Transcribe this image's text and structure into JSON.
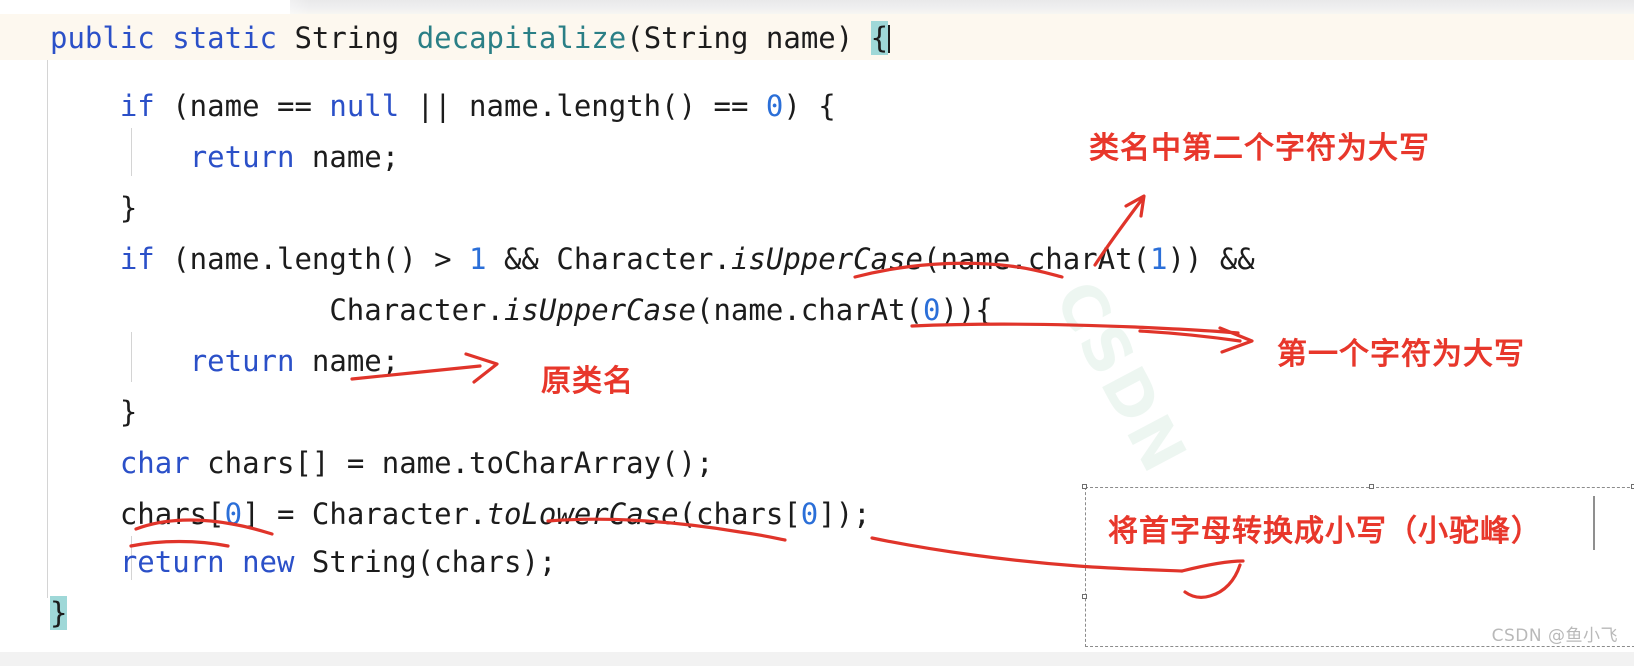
{
  "editor": {
    "language": "java",
    "current_line_highlight_color": "#fdf8ef",
    "matching_brace_highlight_color": "#9fd8d8",
    "keyword_color": "#2b50c8",
    "number_color": "#2b6fd8",
    "method_color": "#2a7f86",
    "text_color": "#1c1c1c",
    "code_lines": [
      {
        "id": "line-signature",
        "text": "public static String decapitalize(String name) {"
      },
      {
        "id": "line-null-check",
        "text": "    if (name == null || name.length() == 0) {"
      },
      {
        "id": "line-return-name-1",
        "text": "        return name;"
      },
      {
        "id": "line-close-brace-1",
        "text": "    }"
      },
      {
        "id": "line-upper-check-a",
        "text": "    if (name.length() > 1 && Character.isUpperCase(name.charAt(1)) &&"
      },
      {
        "id": "line-upper-check-b",
        "text": "                Character.isUpperCase(name.charAt(0))){"
      },
      {
        "id": "line-return-name-2",
        "text": "        return name;"
      },
      {
        "id": "line-close-brace-2",
        "text": "    }"
      },
      {
        "id": "line-chars-decl",
        "text": "    char chars[] = name.toCharArray();"
      },
      {
        "id": "line-tolower",
        "text": "    chars[0] = Character.toLowerCase(chars[0]);"
      },
      {
        "id": "line-return-new",
        "text": "    return new String(chars);"
      },
      {
        "id": "line-method-close",
        "text": "}"
      }
    ]
  },
  "annotations": [
    {
      "id": "anno-second-char-upper",
      "text": "类名中第二个字符为大写",
      "color": "#e8372b"
    },
    {
      "id": "anno-original-class-name",
      "text": "原类名",
      "color": "#e8372b"
    },
    {
      "id": "anno-first-char-upper",
      "text": "第一个字符为大写",
      "color": "#e8372b"
    },
    {
      "id": "anno-lowercase-first-letter",
      "text": "将首字母转换成小写（小驼峰）",
      "color": "#e8372b"
    }
  ],
  "watermarks": {
    "diagonal": "CSDN",
    "corner": "CSDN @鱼小飞"
  }
}
